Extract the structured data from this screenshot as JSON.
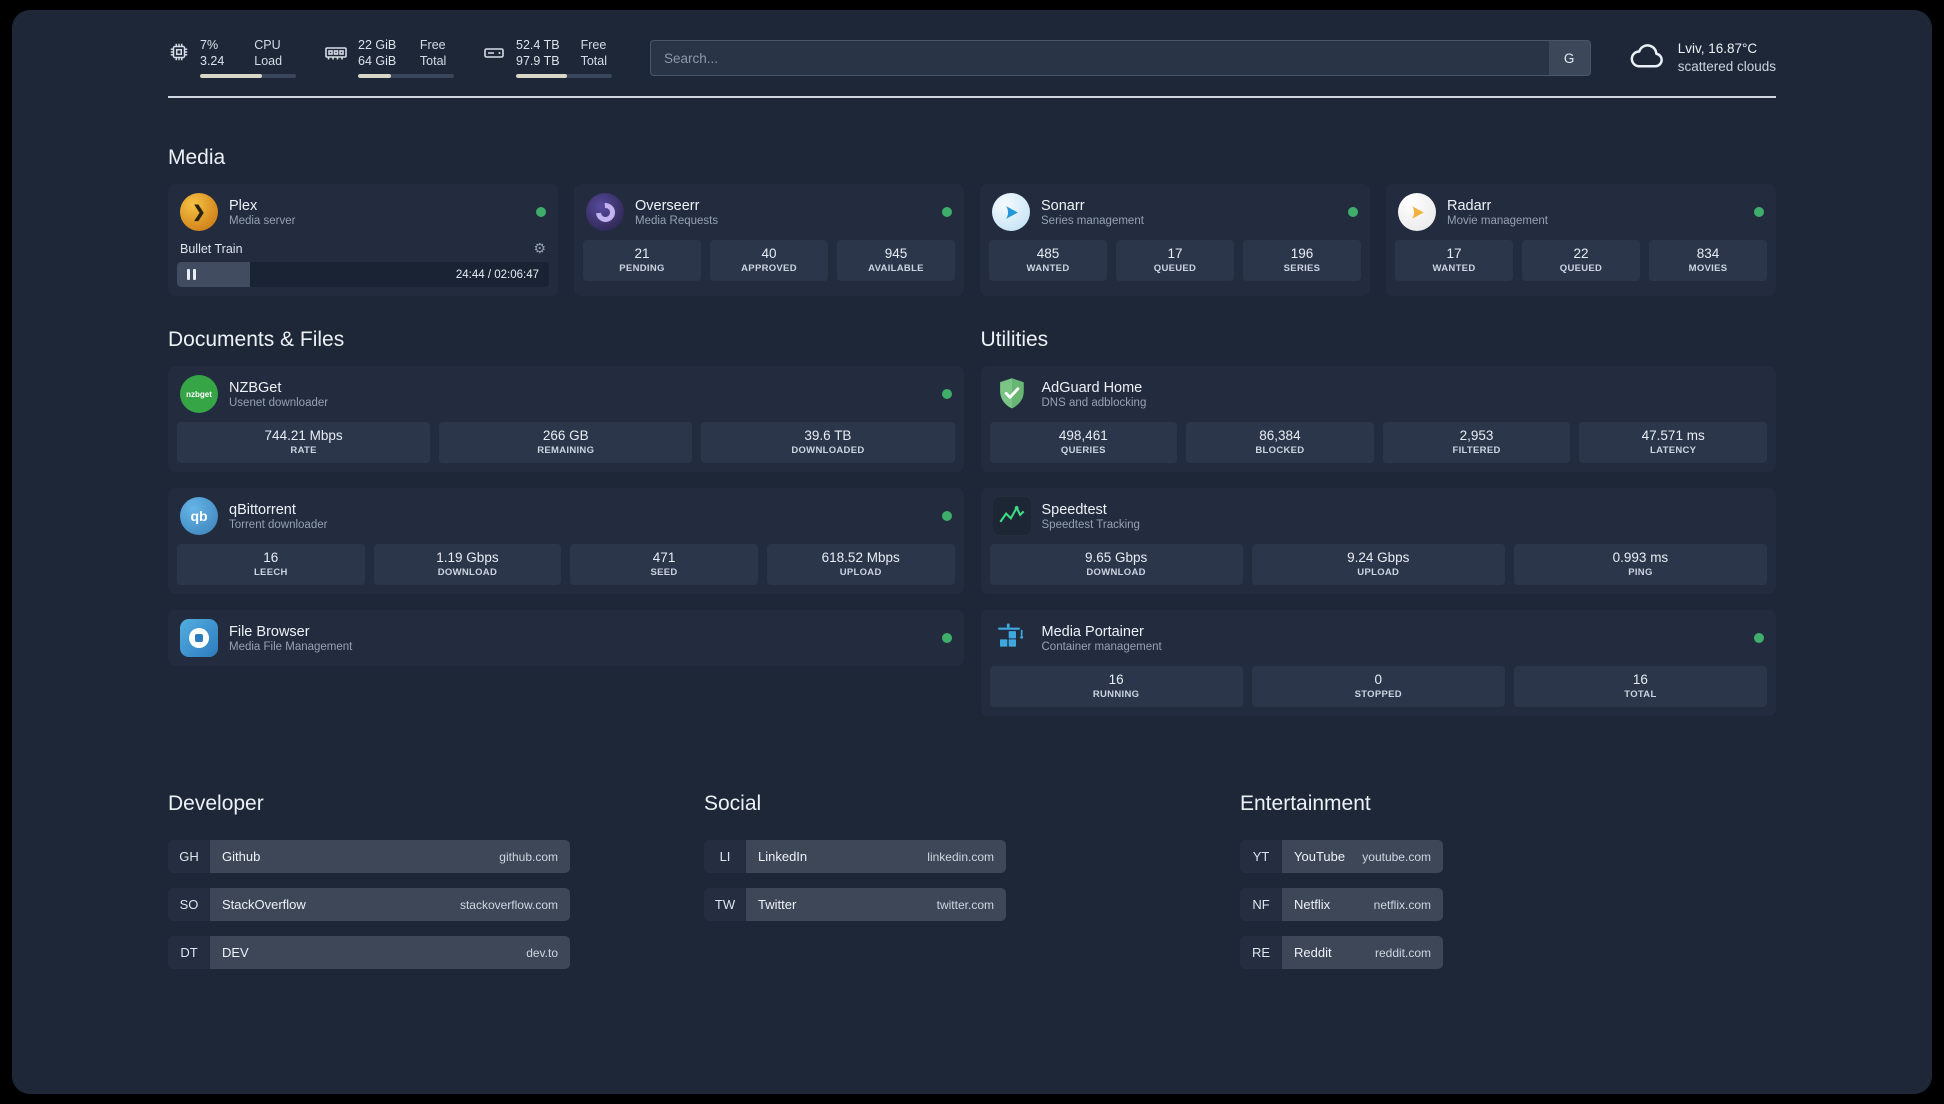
{
  "topbar": {
    "cpu": {
      "value1": "7%",
      "value2": "3.24",
      "label1": "CPU",
      "label2": "Load",
      "bar_pct": 65
    },
    "ram": {
      "value1": "22 GiB",
      "value2": "64 GiB",
      "label1": "Free",
      "label2": "Total",
      "bar_pct": 34
    },
    "disk": {
      "value1": "52.4 TB",
      "value2": "97.9 TB",
      "label1": "Free",
      "label2": "Total",
      "bar_pct": 53
    },
    "search": {
      "placeholder": "Search...",
      "button_label": "G"
    },
    "weather": {
      "location": "Lviv, 16.87°C",
      "condition": "scattered clouds"
    }
  },
  "sections": {
    "media": "Media",
    "documents": "Documents & Files",
    "utilities": "Utilities"
  },
  "glyphs": {
    "plex": "❯",
    "gear": "⚙"
  },
  "colors": {
    "status_online": "#3fae6a",
    "panel_bg": "#1d2737"
  },
  "services": {
    "plex": {
      "name": "Plex",
      "subtitle": "Media server",
      "now_playing": "Bullet Train",
      "time": "24:44 / 02:06:47",
      "progress_pct": 19.5
    },
    "overseerr": {
      "name": "Overseerr",
      "subtitle": "Media Requests",
      "stats": [
        {
          "value": "21",
          "label": "PENDING"
        },
        {
          "value": "40",
          "label": "APPROVED"
        },
        {
          "value": "945",
          "label": "AVAILABLE"
        }
      ]
    },
    "sonarr": {
      "name": "Sonarr",
      "subtitle": "Series management",
      "stats": [
        {
          "value": "485",
          "label": "WANTED"
        },
        {
          "value": "17",
          "label": "QUEUED"
        },
        {
          "value": "196",
          "label": "SERIES"
        }
      ]
    },
    "radarr": {
      "name": "Radarr",
      "subtitle": "Movie management",
      "stats": [
        {
          "value": "17",
          "label": "WANTED"
        },
        {
          "value": "22",
          "label": "QUEUED"
        },
        {
          "value": "834",
          "label": "MOVIES"
        }
      ]
    },
    "nzbget": {
      "name": "NZBGet",
      "subtitle": "Usenet downloader",
      "icon_text": "nzbget",
      "stats": [
        {
          "value": "744.21 Mbps",
          "label": "RATE"
        },
        {
          "value": "266 GB",
          "label": "REMAINING"
        },
        {
          "value": "39.6 TB",
          "label": "DOWNLOADED"
        }
      ]
    },
    "qbittorrent": {
      "name": "qBittorrent",
      "subtitle": "Torrent downloader",
      "icon_text": "qb",
      "stats": [
        {
          "value": "16",
          "label": "LEECH"
        },
        {
          "value": "1.19 Gbps",
          "label": "DOWNLOAD"
        },
        {
          "value": "471",
          "label": "SEED"
        },
        {
          "value": "618.52 Mbps",
          "label": "UPLOAD"
        }
      ]
    },
    "filebrowser": {
      "name": "File Browser",
      "subtitle": "Media File Management"
    },
    "adguard": {
      "name": "AdGuard Home",
      "subtitle": "DNS and adblocking",
      "stats": [
        {
          "value": "498,461",
          "label": "QUERIES"
        },
        {
          "value": "86,384",
          "label": "BLOCKED"
        },
        {
          "value": "2,953",
          "label": "FILTERED"
        },
        {
          "value": "47.571 ms",
          "label": "LATENCY"
        }
      ]
    },
    "speedtest": {
      "name": "Speedtest",
      "subtitle": "Speedtest Tracking",
      "stats": [
        {
          "value": "9.65 Gbps",
          "label": "DOWNLOAD"
        },
        {
          "value": "9.24 Gbps",
          "label": "UPLOAD"
        },
        {
          "value": "0.993 ms",
          "label": "PING"
        }
      ]
    },
    "portainer": {
      "name": "Media Portainer",
      "subtitle": "Container management",
      "stats": [
        {
          "value": "16",
          "label": "RUNNING"
        },
        {
          "value": "0",
          "label": "STOPPED"
        },
        {
          "value": "16",
          "label": "TOTAL"
        }
      ]
    }
  },
  "bookmarks": {
    "developer": {
      "title": "Developer",
      "items": [
        {
          "abbr": "GH",
          "name": "Github",
          "url": "github.com"
        },
        {
          "abbr": "SO",
          "name": "StackOverflow",
          "url": "stackoverflow.com"
        },
        {
          "abbr": "DT",
          "name": "DEV",
          "url": "dev.to"
        }
      ]
    },
    "social": {
      "title": "Social",
      "items": [
        {
          "abbr": "LI",
          "name": "LinkedIn",
          "url": "linkedin.com"
        },
        {
          "abbr": "TW",
          "name": "Twitter",
          "url": "twitter.com"
        }
      ]
    },
    "entertainment": {
      "title": "Entertainment",
      "items": [
        {
          "abbr": "YT",
          "name": "YouTube",
          "url": "youtube.com"
        },
        {
          "abbr": "NF",
          "name": "Netflix",
          "url": "netflix.com"
        },
        {
          "abbr": "RE",
          "name": "Reddit",
          "url": "reddit.com"
        }
      ]
    }
  }
}
